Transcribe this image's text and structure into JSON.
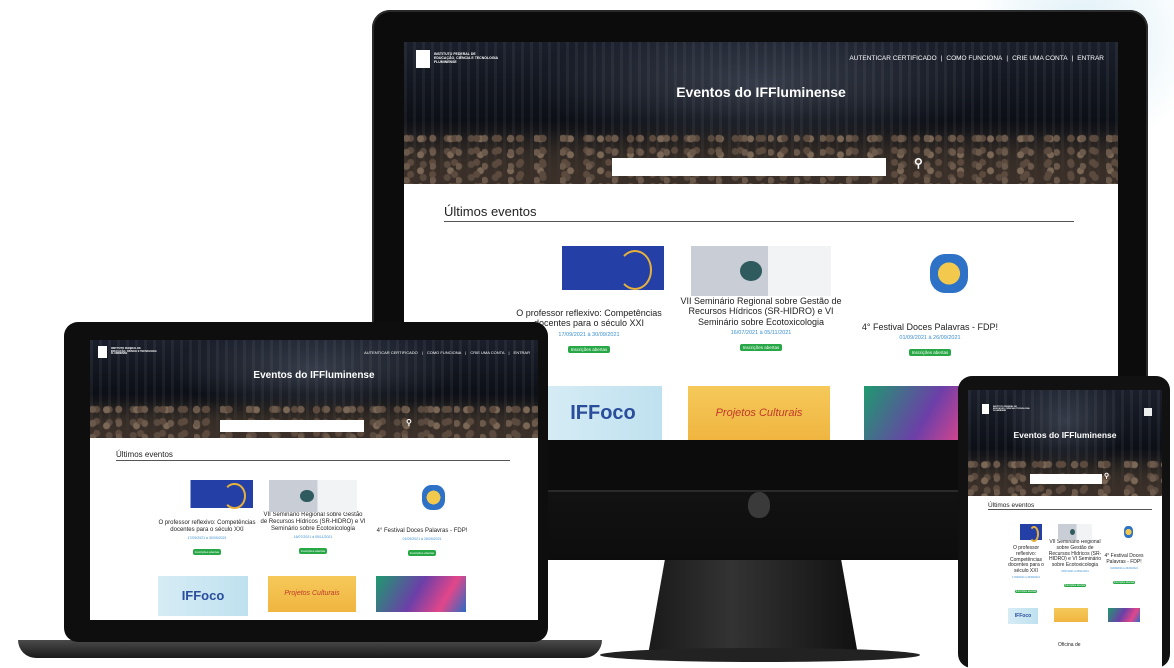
{
  "site": {
    "logo_text": "INSTITUTO FEDERAL DE\nEDUCAÇÃO, CIÊNCIA E TECNOLOGIA\nFLUMINENSE",
    "nav": [
      "AUTENTICAR CERTIFICADO",
      "COMO FUNCIONA",
      "CRIE UMA CONTA",
      "ENTRAR"
    ],
    "nav_separator": "|",
    "hero_title": "Eventos do IFFluminense",
    "search_placeholder": "",
    "search_icon": "search-icon",
    "section_title": "Últimos eventos",
    "events": [
      {
        "title": "O professor reflexivo: Competências docentes para o século XXI",
        "dates": "17/09/2021 à 30/09/2021",
        "status": "Inscrições abertas"
      },
      {
        "title": "VII Seminário Regional sobre Gestão de Recursos Hídricos (SR-HIDRO) e VI Seminário sobre Ecotoxicologia",
        "dates": "16/07/2021 à 05/11/2021",
        "status": "Inscrições abertas"
      },
      {
        "title": "4° Festival Doces Palavras - FDP!",
        "dates": "01/09/2021 à 26/09/2021",
        "status": "Inscrições abertas"
      }
    ],
    "thumb_texts": {
      "surdo": "IFFoco SURDO",
      "projetos": "Projetos Culturais",
      "oficina": "Oficina de"
    },
    "menu_icon": "menu-icon",
    "colors": {
      "badge": "#27a745",
      "date": "#3a8fd1",
      "brand_blue": "#243fa6"
    }
  }
}
